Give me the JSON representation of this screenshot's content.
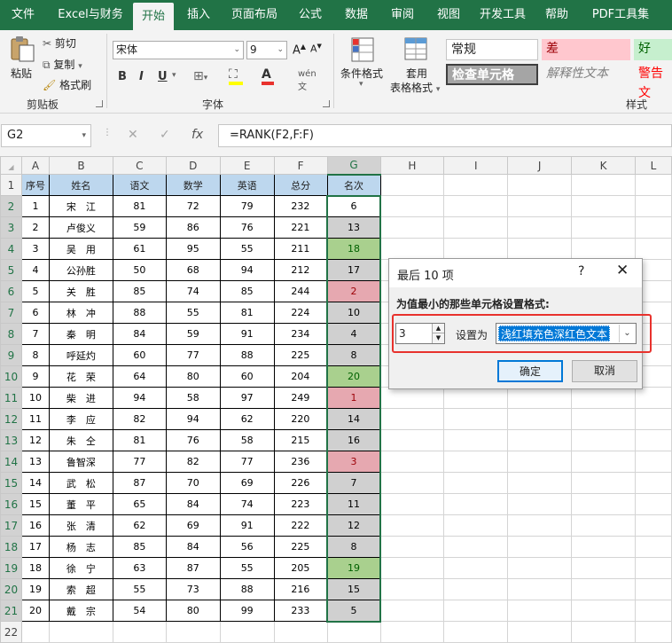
{
  "ribbon_tabs": [
    "文件",
    "Excel与财务",
    "开始",
    "插入",
    "页面布局",
    "公式",
    "数据",
    "审阅",
    "视图",
    "开发工具",
    "帮助",
    "PDF工具集"
  ],
  "active_tab": "开始",
  "clipboard": {
    "paste": "粘贴",
    "cut": "剪切",
    "copy": "复制",
    "format_painter": "格式刷",
    "group": "剪贴板"
  },
  "font": {
    "name": "宋体",
    "size": "9",
    "bold": "B",
    "italic": "I",
    "underline": "U",
    "phonetic": "wén",
    "group": "字体"
  },
  "styles": {
    "conditional_format": "条件格式",
    "table_format_line1": "套用",
    "table_format_line2": "表格格式",
    "normal": "常规",
    "bad": "差",
    "good": "好",
    "check_cell": "检查单元格",
    "explanatory": "解释性文本",
    "warning": "警告文",
    "group": "样式"
  },
  "formula_bar": {
    "name_box": "G2",
    "formula": "=RANK(F2,F:F)",
    "fx": "fx"
  },
  "sheet": {
    "columns": [
      "A",
      "B",
      "C",
      "D",
      "E",
      "F",
      "G",
      "H",
      "I",
      "J",
      "K",
      "L"
    ],
    "headers": [
      "序号",
      "姓名",
      "语文",
      "数学",
      "英语",
      "总分",
      "名次"
    ],
    "rows": [
      [
        "1",
        "宋　江",
        "81",
        "72",
        "79",
        "232",
        "6"
      ],
      [
        "2",
        "卢俊义",
        "59",
        "86",
        "76",
        "221",
        "13"
      ],
      [
        "3",
        "吴　用",
        "61",
        "95",
        "55",
        "211",
        "18"
      ],
      [
        "4",
        "公孙胜",
        "50",
        "68",
        "94",
        "212",
        "17"
      ],
      [
        "5",
        "关　胜",
        "85",
        "74",
        "85",
        "244",
        "2"
      ],
      [
        "6",
        "林　冲",
        "88",
        "55",
        "81",
        "224",
        "10"
      ],
      [
        "7",
        "秦　明",
        "84",
        "59",
        "91",
        "234",
        "4"
      ],
      [
        "8",
        "呼延灼",
        "60",
        "77",
        "88",
        "225",
        "8"
      ],
      [
        "9",
        "花　荣",
        "64",
        "80",
        "60",
        "204",
        "20"
      ],
      [
        "10",
        "柴　进",
        "94",
        "58",
        "97",
        "249",
        "1"
      ],
      [
        "11",
        "李　应",
        "82",
        "94",
        "62",
        "220",
        "14"
      ],
      [
        "12",
        "朱　仝",
        "81",
        "76",
        "58",
        "215",
        "16"
      ],
      [
        "13",
        "鲁智深",
        "77",
        "82",
        "77",
        "236",
        "3"
      ],
      [
        "14",
        "武　松",
        "87",
        "70",
        "69",
        "226",
        "7"
      ],
      [
        "15",
        "董　平",
        "65",
        "84",
        "74",
        "223",
        "11"
      ],
      [
        "16",
        "张　清",
        "62",
        "69",
        "91",
        "222",
        "12"
      ],
      [
        "17",
        "杨　志",
        "85",
        "84",
        "56",
        "225",
        "8"
      ],
      [
        "18",
        "徐　宁",
        "63",
        "87",
        "55",
        "205",
        "19"
      ],
      [
        "19",
        "索　超",
        "55",
        "73",
        "88",
        "216",
        "15"
      ],
      [
        "20",
        "戴　宗",
        "54",
        "80",
        "99",
        "233",
        "5"
      ]
    ],
    "rank_fill": [
      "white",
      "grey",
      "green",
      "grey",
      "red",
      "grey",
      "grey",
      "grey",
      "green",
      "red",
      "grey",
      "grey",
      "red",
      "grey",
      "grey",
      "grey",
      "grey",
      "green",
      "grey",
      "grey"
    ],
    "row_numbers": [
      "1",
      "2",
      "3",
      "4",
      "5",
      "6",
      "7",
      "8",
      "9",
      "10",
      "11",
      "12",
      "13",
      "14",
      "15",
      "16",
      "17",
      "18",
      "19",
      "20",
      "21",
      "22"
    ]
  },
  "dialog": {
    "title": "最后 10 项",
    "help": "?",
    "close": "✕",
    "prompt": "为值最小的那些单元格设置格式:",
    "count": "3",
    "set_as": "设置为",
    "format_option": "浅红填充色深红色文本",
    "ok": "确定",
    "cancel": "取消"
  },
  "colors": {
    "excel_green": "#217346",
    "header_fill": "#bdd7ee",
    "light_red_fill": "#e6a8b0",
    "green_fill": "#a9d08e",
    "grey_fill": "#d0d0d0",
    "highlight_box": "#e8322d"
  }
}
